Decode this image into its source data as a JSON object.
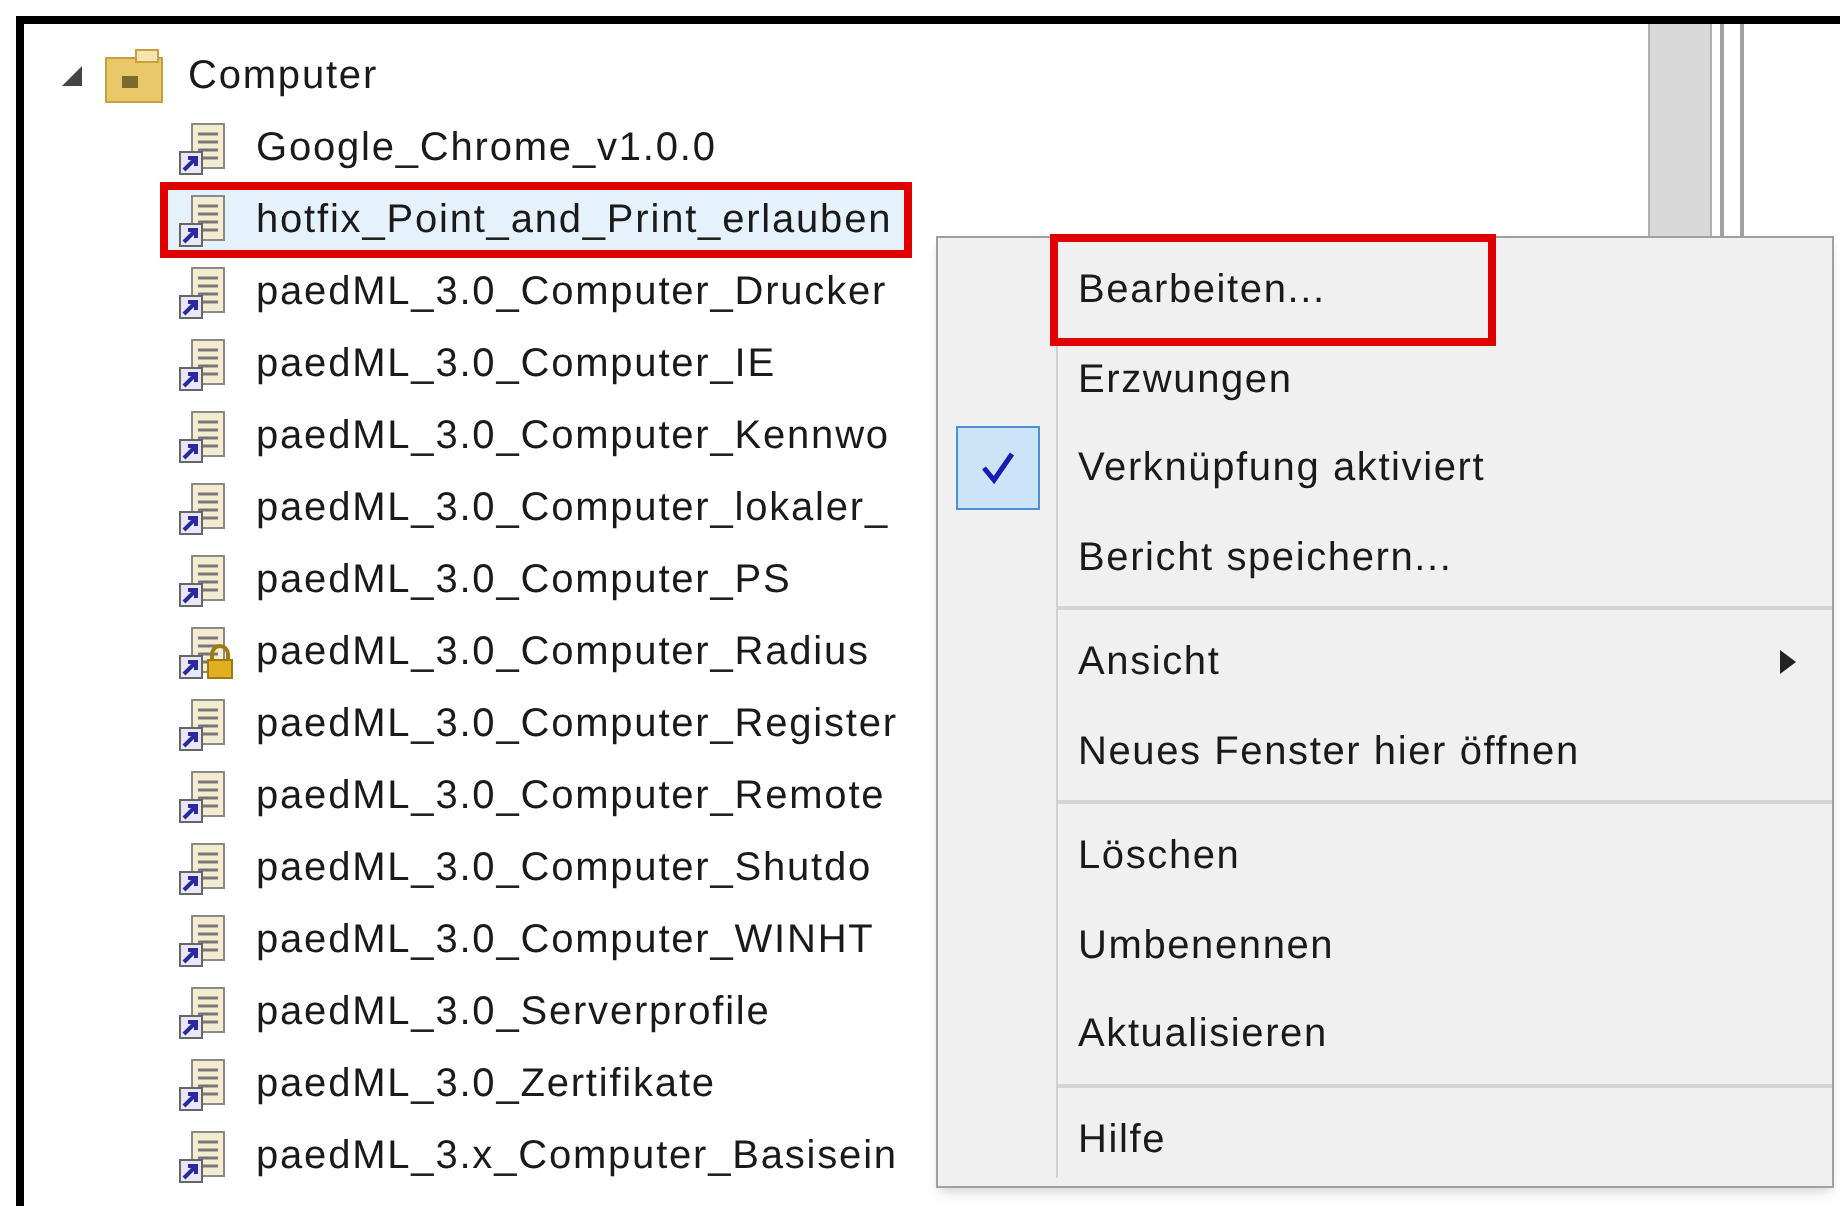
{
  "tree": {
    "label": "Computer",
    "expanded": true,
    "children": [
      {
        "label": "Google_Chrome_v1.0.0",
        "locked": false,
        "highlighted": false
      },
      {
        "label": "hotfix_Point_and_Print_erlauben",
        "locked": false,
        "highlighted": true
      },
      {
        "label": "paedML_3.0_Computer_Drucker",
        "locked": false,
        "highlighted": false
      },
      {
        "label": "paedML_3.0_Computer_IE",
        "locked": false,
        "highlighted": false
      },
      {
        "label": "paedML_3.0_Computer_Kennwo",
        "locked": false,
        "highlighted": false
      },
      {
        "label": "paedML_3.0_Computer_lokaler_",
        "locked": false,
        "highlighted": false
      },
      {
        "label": "paedML_3.0_Computer_PS",
        "locked": false,
        "highlighted": false
      },
      {
        "label": "paedML_3.0_Computer_Radius",
        "locked": true,
        "highlighted": false
      },
      {
        "label": "paedML_3.0_Computer_Register",
        "locked": false,
        "highlighted": false
      },
      {
        "label": "paedML_3.0_Computer_Remote",
        "locked": false,
        "highlighted": false
      },
      {
        "label": "paedML_3.0_Computer_Shutdo",
        "locked": false,
        "highlighted": false
      },
      {
        "label": "paedML_3.0_Computer_WINHT",
        "locked": false,
        "highlighted": false
      },
      {
        "label": "paedML_3.0_Serverprofile",
        "locked": false,
        "highlighted": false
      },
      {
        "label": "paedML_3.0_Zertifikate",
        "locked": false,
        "highlighted": false
      },
      {
        "label": "paedML_3.x_Computer_Basisein",
        "locked": false,
        "highlighted": false
      }
    ]
  },
  "context_menu": {
    "sections": [
      [
        {
          "label": "Bearbeiten...",
          "checked": false,
          "submenu": false,
          "highlighted": true
        },
        {
          "label": "Erzwungen",
          "checked": false,
          "submenu": false,
          "highlighted": false
        },
        {
          "label": "Verknüpfung aktiviert",
          "checked": true,
          "submenu": false,
          "highlighted": false
        },
        {
          "label": "Bericht speichern...",
          "checked": false,
          "submenu": false,
          "highlighted": false
        }
      ],
      [
        {
          "label": "Ansicht",
          "checked": false,
          "submenu": true,
          "highlighted": false
        },
        {
          "label": "Neues Fenster hier öffnen",
          "checked": false,
          "submenu": false,
          "highlighted": false
        }
      ],
      [
        {
          "label": "Löschen",
          "checked": false,
          "submenu": false,
          "highlighted": false
        },
        {
          "label": "Umbenennen",
          "checked": false,
          "submenu": false,
          "highlighted": false
        },
        {
          "label": "Aktualisieren",
          "checked": false,
          "submenu": false,
          "highlighted": false
        }
      ],
      [
        {
          "label": "Hilfe",
          "checked": false,
          "submenu": false,
          "highlighted": false
        }
      ]
    ]
  }
}
